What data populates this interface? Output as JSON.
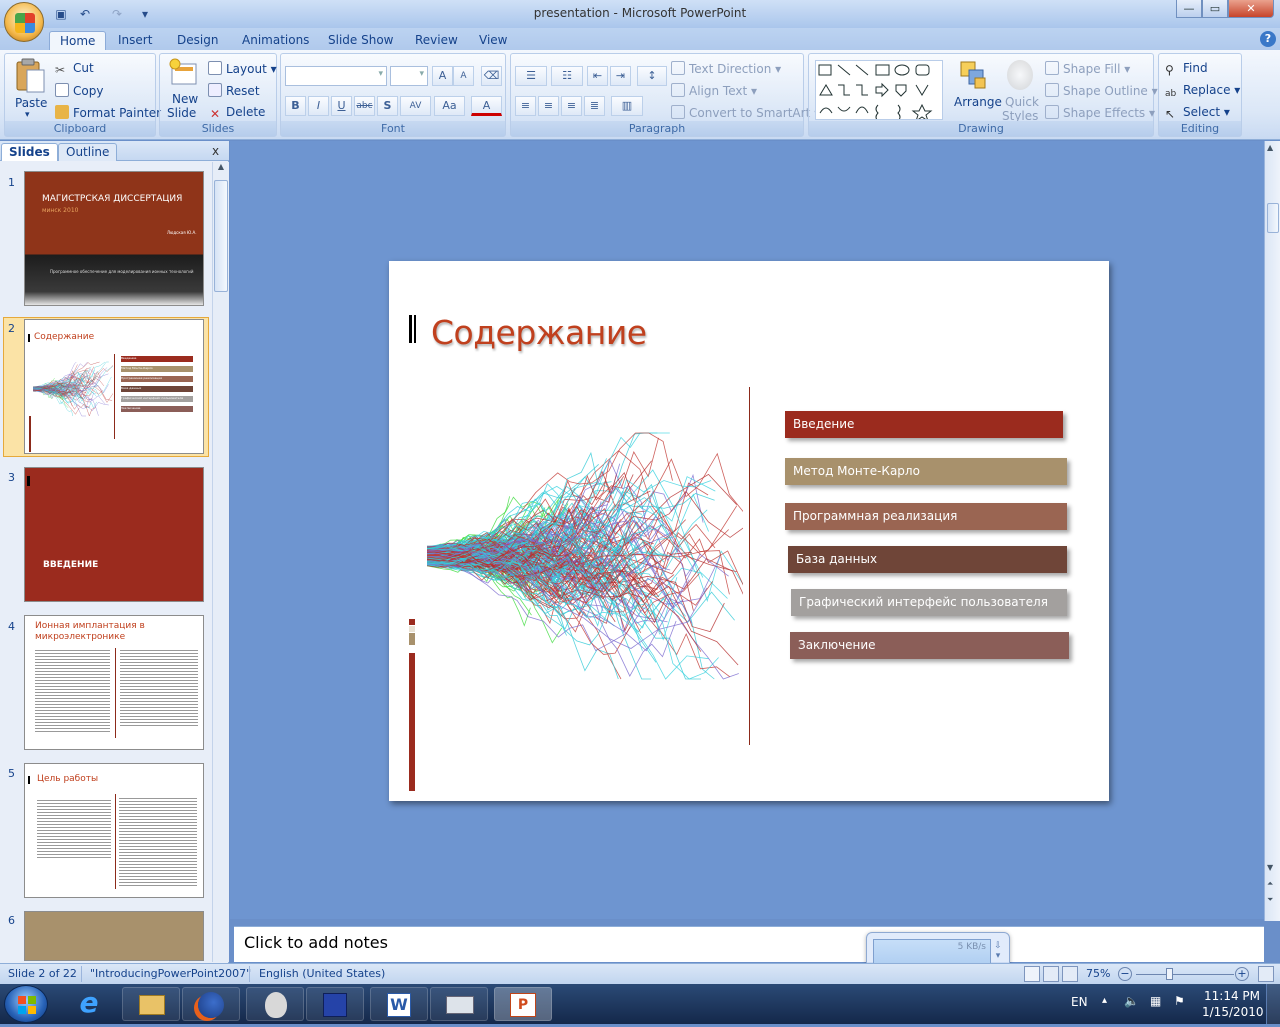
{
  "window": {
    "title": "presentation - Microsoft PowerPoint"
  },
  "qat": {
    "save": "save-icon",
    "undo": "undo-icon",
    "redo": "redo-icon",
    "customize": "▾"
  },
  "window_controls": {
    "minimize": "—",
    "maximize": "▭",
    "close": "✕"
  },
  "tabs": [
    "Home",
    "Insert",
    "Design",
    "Animations",
    "Slide Show",
    "Review",
    "View"
  ],
  "ribbon": {
    "clipboard": {
      "label": "Clipboard",
      "paste": "Paste",
      "cut": "Cut",
      "copy": "Copy",
      "format_painter": "Format Painter"
    },
    "slides": {
      "label": "Slides",
      "new_slide": "New",
      "new_slide2": "Slide",
      "layout": "Layout",
      "reset": "Reset",
      "delete": "Delete"
    },
    "font": {
      "label": "Font",
      "bold": "B",
      "italic": "I",
      "underline": "U",
      "strike": "abc",
      "shadow": "S",
      "spacing": "AV",
      "case": "Aa",
      "color": "A",
      "grow": "A",
      "shrink": "A"
    },
    "paragraph": {
      "label": "Paragraph",
      "text_direction": "Text Direction",
      "align_text": "Align Text",
      "convert_smartart": "Convert to SmartArt"
    },
    "drawing": {
      "label": "Drawing",
      "arrange": "Arrange",
      "quick_styles": "Quick",
      "quick_styles2": "Styles",
      "shape_fill": "Shape Fill",
      "shape_outline": "Shape Outline",
      "shape_effects": "Shape Effects"
    },
    "editing": {
      "label": "Editing",
      "find": "Find",
      "replace": "Replace",
      "select": "Select"
    }
  },
  "pane": {
    "tab_slides": "Slides",
    "tab_outline": "Outline",
    "close": "x",
    "thumbs": [
      {
        "num": "1",
        "title": "МАГИСТРСКАЯ ДИССЕРТАЦИЯ",
        "sub": "минск 2010",
        "author": "Людская Ю.А.",
        "footer": "Программное обеспечение для моделирования ионных технологий"
      },
      {
        "num": "2",
        "title": "Содержание",
        "items": [
          "Введение",
          "Метод Монте-Карло",
          "Программная реализация",
          "База данных",
          "Графический интерфейс пользователя",
          "Заключение"
        ]
      },
      {
        "num": "3",
        "title": "ВВЕДЕНИЕ"
      },
      {
        "num": "4",
        "title": "Ионная имплантация в микроэлектронике"
      },
      {
        "num": "5",
        "title": "Цель работы"
      },
      {
        "num": "6"
      }
    ]
  },
  "slide": {
    "title": "Содержание",
    "menu": [
      {
        "label": "Введение",
        "color": "#9b2b1e"
      },
      {
        "label": "Метод Монте-Карло",
        "color": "#a8916c"
      },
      {
        "label": "Программная реализация",
        "color": "#9a6552"
      },
      {
        "label": "База данных",
        "color": "#6f4538"
      },
      {
        "label": "Графический интерфейс пользователя",
        "color": "#a3a09e"
      },
      {
        "label": "Заключение",
        "color": "#8b5e58"
      }
    ]
  },
  "notes": {
    "placeholder": "Click to add notes"
  },
  "status": {
    "slide_info": "Slide 2 of 22",
    "theme": "\"IntroducingPowerPoint2007\"",
    "language": "English (United States)",
    "zoom": "75%"
  },
  "network": {
    "speed": "5 KB/s"
  },
  "taskbar": {
    "apps": [
      "explorer-icon",
      "firefox-icon",
      "alien-icon",
      "floppy-icon",
      "word-icon",
      "printer-icon",
      "powerpoint-icon"
    ],
    "lang": "EN",
    "time": "11:14 PM",
    "date": "1/15/2010"
  },
  "colors": {
    "accent": "#c0401e",
    "ribbon_bg": "#dbe7f7",
    "workspace": "#6e95d0"
  }
}
